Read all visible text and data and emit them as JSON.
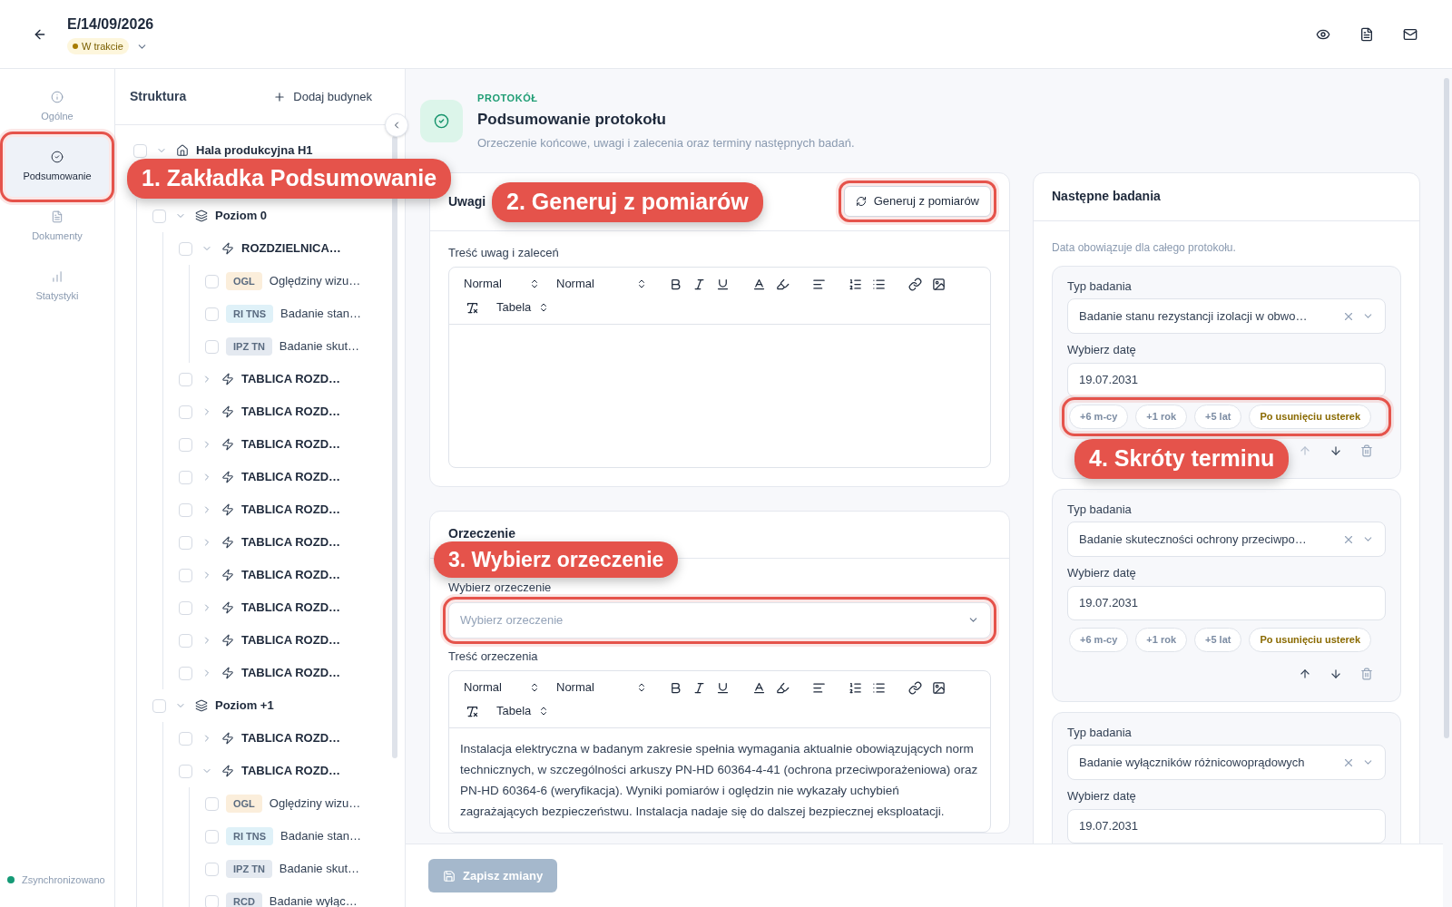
{
  "header": {
    "title": "E/14/09/2026",
    "status": "W trakcie"
  },
  "nav": {
    "items": [
      {
        "kind": "info",
        "label": "Ogólne",
        "selected": false,
        "highlighted": false
      },
      {
        "kind": "summary",
        "label": "Podsumowanie",
        "selected": true,
        "highlighted": true,
        "callout": "1. Zakładka Podsumowanie"
      },
      {
        "kind": "documents",
        "label": "Dokumenty",
        "selected": false,
        "highlighted": false
      },
      {
        "kind": "stats",
        "label": "Statystyki",
        "selected": false,
        "highlighted": false
      }
    ],
    "sync": "Zsynchronizowano"
  },
  "tree": {
    "title": "Struktura",
    "add": "Dodaj budynek",
    "nodes": [
      {
        "kind": "building",
        "label": "Hala produkcyjna H1",
        "checked": false,
        "expanded": true,
        "children": [
          {
            "kind": "level",
            "label": "Poziom 0",
            "checked": false,
            "expanded": true,
            "children": [
              {
                "kind": "board",
                "label": "ROZDZIELNICA…",
                "checked": false,
                "expanded": true,
                "children": [
                  {
                    "kind": "test",
                    "code": "OGL",
                    "color": "#fbeedb",
                    "label": "Oględziny wizu…",
                    "checked": false
                  },
                  {
                    "kind": "test",
                    "code": "RI TNS",
                    "color": "#dff1f8",
                    "label": "Badanie stan…",
                    "checked": false
                  },
                  {
                    "kind": "test",
                    "code": "IPZ TN",
                    "color": "#e4e9f0",
                    "label": "Badanie skut…",
                    "checked": false
                  }
                ]
              },
              {
                "kind": "board",
                "label": "TABLICA ROZD…",
                "checked": false,
                "expanded": false
              },
              {
                "kind": "board",
                "label": "TABLICA ROZD…",
                "checked": false,
                "expanded": false
              },
              {
                "kind": "board",
                "label": "TABLICA ROZD…",
                "checked": false,
                "expanded": false
              },
              {
                "kind": "board",
                "label": "TABLICA ROZD…",
                "checked": false,
                "expanded": false
              },
              {
                "kind": "board",
                "label": "TABLICA ROZD…",
                "checked": false,
                "expanded": false
              },
              {
                "kind": "board",
                "label": "TABLICA ROZD…",
                "checked": false,
                "expanded": false
              },
              {
                "kind": "board",
                "label": "TABLICA ROZD…",
                "checked": false,
                "expanded": false
              },
              {
                "kind": "board",
                "label": "TABLICA ROZD…",
                "checked": false,
                "expanded": false
              },
              {
                "kind": "board",
                "label": "TABLICA ROZD…",
                "checked": false,
                "expanded": false
              },
              {
                "kind": "board",
                "label": "TABLICA ROZD…",
                "checked": false,
                "expanded": false
              }
            ]
          },
          {
            "kind": "level",
            "label": "Poziom +1",
            "checked": false,
            "expanded": true,
            "children": [
              {
                "kind": "board",
                "label": "TABLICA ROZD…",
                "checked": false,
                "expanded": false
              },
              {
                "kind": "board",
                "label": "TABLICA ROZD…",
                "checked": false,
                "expanded": true,
                "children": [
                  {
                    "kind": "test",
                    "code": "OGL",
                    "color": "#fbeedb",
                    "label": "Oględziny wizu…",
                    "checked": false
                  },
                  {
                    "kind": "test",
                    "code": "RI TNS",
                    "color": "#dff1f8",
                    "label": "Badanie stan…",
                    "checked": false
                  },
                  {
                    "kind": "test",
                    "code": "IPZ TN",
                    "color": "#e4e9f0",
                    "label": "Badanie skut…",
                    "checked": false
                  },
                  {
                    "kind": "test",
                    "code": "RCD",
                    "color": "#e4e9f0",
                    "label": "Badanie wyłąc…",
                    "checked": false
                  }
                ]
              }
            ]
          }
        ]
      }
    ]
  },
  "protocol": {
    "eyebrow": "PROTOKÓŁ",
    "title": "Podsumowanie protokołu",
    "subtitle": "Orzeczenie końcowe, uwagi i zalecenia oraz terminy następnych badań."
  },
  "remarks": {
    "title": "Uwagi",
    "callout": "2. Generuj z pomiarów",
    "generate": {
      "label": "Generuj z pomiarów",
      "highlighted": true
    },
    "field_label": "Treść uwag i zaleceń",
    "editor": {
      "header": "Normal",
      "size": "Normal",
      "table": "Tabela"
    }
  },
  "verdict": {
    "title": "Orzeczenie",
    "callout": "3. Wybierz orzeczenie",
    "select_label": "Wybierz orzeczenie",
    "select": {
      "placeholder": "Wybierz orzeczenie",
      "highlighted": true
    },
    "field_label": "Treść orzeczenia",
    "editor": {
      "header": "Normal",
      "size": "Normal",
      "table": "Tabela",
      "value": "Instalacja elektryczna w badanym zakresie spełnia wymagania aktualnie obowiązujących norm technicznych, w szczególności arkuszy PN-HD 60364-4-41 (ochrona przeciwporażeniowa) oraz PN-HD 60364-6 (weryfikacja). Wyniki pomiarów i oględzin nie wykazały uchybień zagrażających bezpieczeństwu. Instalacja nadaje się do dalszej bezpiecznej eksploatacji."
    }
  },
  "next_tests": {
    "title": "Następne badania",
    "note": "Data obowiązuje dla całego protokołu.",
    "items": [
      {
        "type_label": "Typ badania",
        "type": "Badanie stanu rezystancji izolacji w obwo…",
        "date_label": "Wybierz datę",
        "date": "19.07.2031",
        "shortcuts_highlighted": true,
        "callout": "4. Skróty terminu",
        "up_disabled": true,
        "shortcuts": [
          {
            "kind": "offset",
            "label": "+6 m-cy"
          },
          {
            "kind": "offset",
            "label": "+1 rok"
          },
          {
            "kind": "offset",
            "label": "+5 lat"
          },
          {
            "kind": "condition",
            "label": "Po usunięciu usterek"
          }
        ]
      },
      {
        "type_label": "Typ badania",
        "type": "Badanie skuteczności ochrony przeciwpo…",
        "date_label": "Wybierz datę",
        "date": "19.07.2031",
        "shortcuts_highlighted": false,
        "up_disabled": false,
        "shortcuts": [
          {
            "kind": "offset",
            "label": "+6 m-cy"
          },
          {
            "kind": "offset",
            "label": "+1 rok"
          },
          {
            "kind": "offset",
            "label": "+5 lat"
          },
          {
            "kind": "condition",
            "label": "Po usunięciu usterek"
          }
        ]
      },
      {
        "type_label": "Typ badania",
        "type": "Badanie wyłączników różnicowoprądowych",
        "date_label": "Wybierz datę",
        "date": "19.07.2031"
      }
    ]
  },
  "footer": {
    "save": {
      "label": "Zapisz zmiany",
      "disabled": true
    }
  }
}
